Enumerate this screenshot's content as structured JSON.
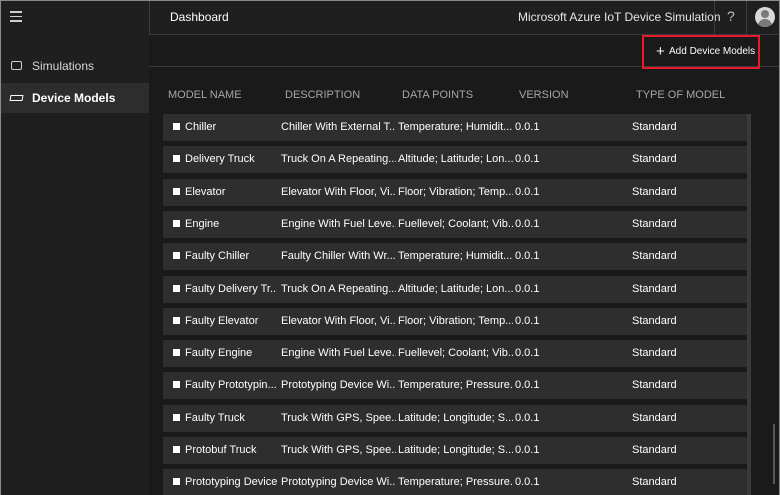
{
  "header": {
    "page_title": "Dashboard",
    "app_name": "Microsoft Azure IoT Device Simulation",
    "help": "?"
  },
  "sidebar": {
    "items": [
      {
        "label": "Simulations",
        "icon": "simulation-icon",
        "active": false
      },
      {
        "label": "Device Models",
        "icon": "device-model-icon",
        "active": true
      }
    ]
  },
  "toolbar": {
    "add_button_label": "Add Device Models",
    "add_icon": "+"
  },
  "table": {
    "columns": [
      "MODEL NAME",
      "DESCRIPTION",
      "DATA POINTS",
      "VERSION",
      "TYPE OF MODEL"
    ],
    "rows": [
      {
        "name": "Chiller",
        "description": "Chiller With External T...",
        "data_points": "Temperature; Humidit...",
        "version": "0.0.1",
        "type": "Standard"
      },
      {
        "name": "Delivery Truck",
        "description": "Truck On A Repeating...",
        "data_points": "Altitude; Latitude; Lon...",
        "version": "0.0.1",
        "type": "Standard"
      },
      {
        "name": "Elevator",
        "description": "Elevator With Floor, Vi...",
        "data_points": "Floor; Vibration; Temp...",
        "version": "0.0.1",
        "type": "Standard"
      },
      {
        "name": "Engine",
        "description": "Engine With Fuel Leve...",
        "data_points": "Fuellevel; Coolant; Vib...",
        "version": "0.0.1",
        "type": "Standard"
      },
      {
        "name": "Faulty Chiller",
        "description": "Faulty Chiller With Wr...",
        "data_points": "Temperature; Humidit...",
        "version": "0.0.1",
        "type": "Standard"
      },
      {
        "name": "Faulty Delivery Tr...",
        "description": "Truck On A Repeating...",
        "data_points": "Altitude; Latitude; Lon...",
        "version": "0.0.1",
        "type": "Standard"
      },
      {
        "name": "Faulty Elevator",
        "description": "Elevator With Floor, Vi...",
        "data_points": "Floor; Vibration; Temp...",
        "version": "0.0.1",
        "type": "Standard"
      },
      {
        "name": "Faulty Engine",
        "description": "Engine With Fuel Leve...",
        "data_points": "Fuellevel; Coolant; Vib...",
        "version": "0.0.1",
        "type": "Standard"
      },
      {
        "name": "Faulty Prototypin...",
        "description": "Prototyping Device Wi...",
        "data_points": "Temperature; Pressure...",
        "version": "0.0.1",
        "type": "Standard"
      },
      {
        "name": "Faulty Truck",
        "description": "Truck With GPS, Spee...",
        "data_points": "Latitude; Longitude; S...",
        "version": "0.0.1",
        "type": "Standard"
      },
      {
        "name": "Protobuf Truck",
        "description": "Truck With GPS, Spee...",
        "data_points": "Latitude; Longitude; S...",
        "version": "0.0.1",
        "type": "Standard"
      },
      {
        "name": "Prototyping Device",
        "description": "Prototyping Device Wi...",
        "data_points": "Temperature; Pressure...",
        "version": "0.0.1",
        "type": "Standard"
      }
    ]
  },
  "colors": {
    "highlight": "#e8192c",
    "background": "#1a1a1a",
    "row": "#2e2e2e"
  }
}
